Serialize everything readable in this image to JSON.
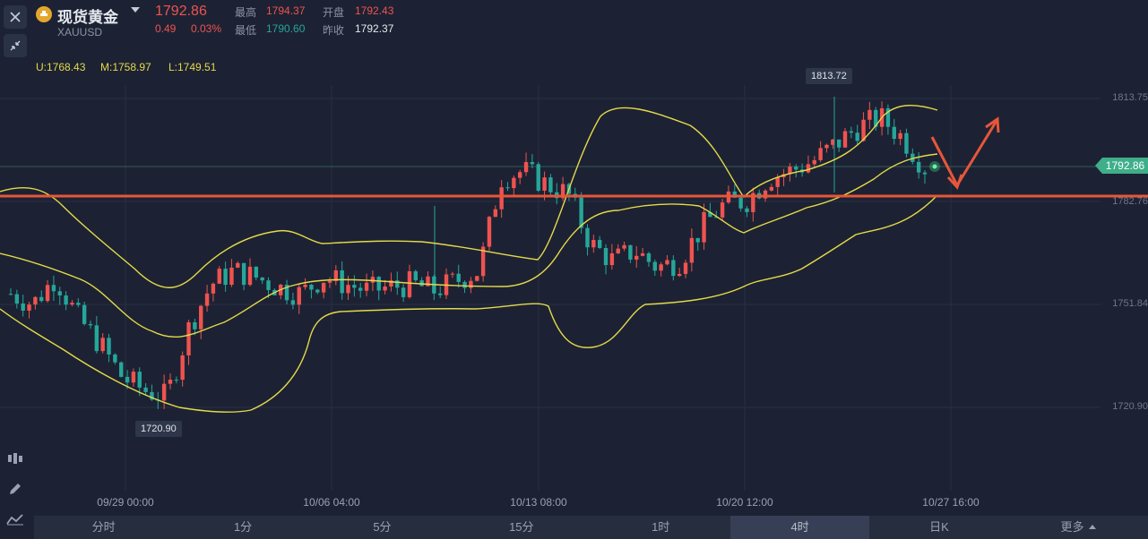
{
  "header": {
    "title": "现货黄金",
    "symbol": "XAUUSD",
    "price": "1792.86",
    "change": "0.49",
    "change_pct": "0.03%",
    "stats": {
      "high_label": "最高",
      "high": "1794.37",
      "open_label": "开盘",
      "open": "1792.43",
      "low_label": "最低",
      "low": "1790.60",
      "prev_close_label": "昨收",
      "prev_close": "1792.37"
    }
  },
  "indicator": {
    "upper": "U:1768.43",
    "middle": "M:1758.97",
    "lower": "L:1749.51"
  },
  "chart": {
    "y_ticks": [
      "1813.75",
      "1782.76",
      "1751.84",
      "1720.90"
    ],
    "x_ticks": [
      "09/29 00:00",
      "10/06 04:00",
      "10/13 08:00",
      "10/20 12:00",
      "10/27 16:00"
    ],
    "current_price_tag": "1792.86",
    "max_tag": "1813.72",
    "min_tag": "1720.90"
  },
  "timeframes": [
    "分时",
    "1分",
    "5分",
    "15分",
    "1时",
    "4时",
    "日K",
    "更多"
  ],
  "active_timeframe": "4时",
  "colors": {
    "up": "#ef5350",
    "down": "#26a69a",
    "band": "#e5d94a",
    "support": "#e8563a"
  },
  "icons": {
    "close": "close-icon",
    "collapse": "collapse-icon",
    "logo": "gold-coin-icon",
    "indicators": "indicator-icon",
    "draw": "pencil-icon",
    "chart-type": "line-chart-icon"
  }
}
